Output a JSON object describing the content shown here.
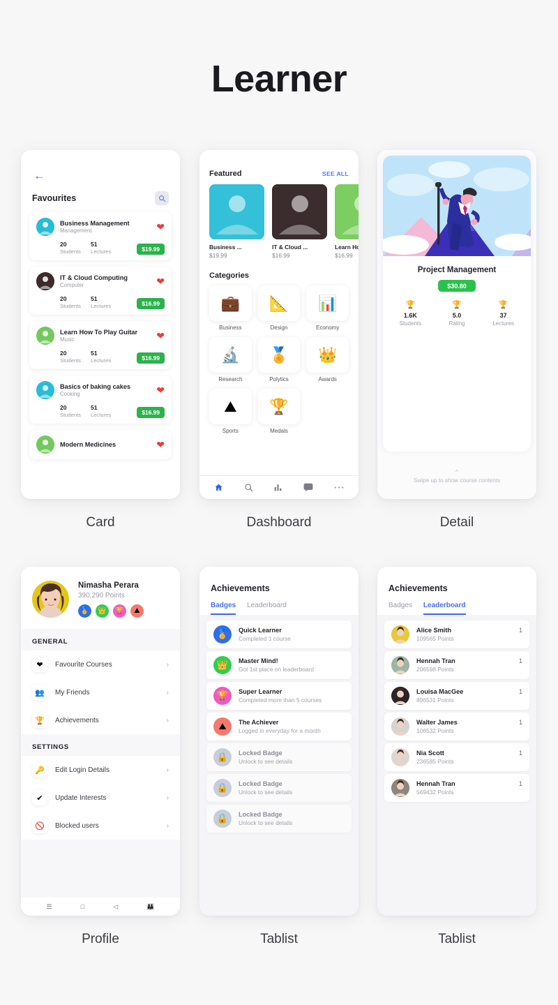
{
  "title": "Learner",
  "captions": {
    "card": "Card",
    "dashboard": "Dashboard",
    "detail": "Detail",
    "profile": "Profile",
    "tablist1": "Tablist",
    "tablist2": "Tablist"
  },
  "card_screen": {
    "back_icon": "back-arrow-icon",
    "header": "Favourites",
    "search_icon": "search-icon",
    "students_label": "Students",
    "lectures_label": "Lectures",
    "courses": [
      {
        "name": "Business Management",
        "category": "Management",
        "students": "20",
        "lectures": "51",
        "price": "$19.99",
        "avatar_color": "#29bcd8",
        "favorite": true
      },
      {
        "name": "IT & Cloud Computing",
        "category": "Computer",
        "students": "20",
        "lectures": "51",
        "price": "$16.99",
        "avatar_color": "#3c2a2c",
        "favorite": true
      },
      {
        "name": "Learn How To Play Guitar",
        "category": "Music",
        "students": "20",
        "lectures": "51",
        "price": "$16.99",
        "avatar_color": "#74c95e",
        "favorite": true
      },
      {
        "name": "Basics of baking cakes",
        "category": "Cooking",
        "students": "20",
        "lectures": "51",
        "price": "$16.99",
        "avatar_color": "#29bcd8",
        "favorite": true
      },
      {
        "name": "Modern Medicines",
        "category": "",
        "students": "",
        "lectures": "",
        "price": "",
        "avatar_color": "#74c95e",
        "favorite": true
      }
    ]
  },
  "dashboard_screen": {
    "featured_title": "Featured",
    "see_all": "SEE ALL",
    "categories_title": "Categories",
    "featured": [
      {
        "name": "Business ...",
        "price": "$19.99",
        "bg": "#34c0d8"
      },
      {
        "name": "IT & Cloud ...",
        "price": "$16.99",
        "bg": "#3b2c2e"
      },
      {
        "name": "Learn How",
        "price": "$16.99",
        "bg": "#7bce5f"
      }
    ],
    "categories": [
      {
        "label": "Business",
        "icon": "briefcase-icon"
      },
      {
        "label": "Design",
        "icon": "ruler-pencil-icon"
      },
      {
        "label": "Economy",
        "icon": "pie-chart-icon"
      },
      {
        "label": "Research",
        "icon": "microscope-icon"
      },
      {
        "label": "Polytics",
        "icon": "medal-icon"
      },
      {
        "label": "Awards",
        "icon": "crown-icon"
      },
      {
        "label": "Sports",
        "icon": "mountain-flag-icon"
      },
      {
        "label": "Medals",
        "icon": "trophy-icon"
      }
    ],
    "tabbar": [
      {
        "icon": "home-icon",
        "active": true
      },
      {
        "icon": "search-icon",
        "active": false
      },
      {
        "icon": "chart-bars-icon",
        "active": false
      },
      {
        "icon": "chat-icon",
        "active": false
      },
      {
        "icon": "more-dots-icon",
        "active": false
      }
    ]
  },
  "detail_screen": {
    "course_title": "Project Management",
    "price": "$30.80",
    "stats": [
      {
        "icon": "trophy-icon",
        "value": "1.6K",
        "label": "Students"
      },
      {
        "icon": "trophy-icon",
        "value": "5.0",
        "label": "Rating"
      },
      {
        "icon": "trophy-icon",
        "value": "37",
        "label": "Lectures"
      }
    ],
    "swipe_chevron": "chevron-up-icon",
    "swipe_text": "Swipe up to show course contents"
  },
  "profile_screen": {
    "name": "Nimasha Perara",
    "points": "390,290 Points",
    "badges": [
      {
        "icon": "medal-icon",
        "color": "#2f6fe8"
      },
      {
        "icon": "crown-icon",
        "color": "#2ece4e"
      },
      {
        "icon": "trophy-icon",
        "color": "#f05ac0"
      },
      {
        "icon": "mountain-flag-icon",
        "color": "#f4796c"
      }
    ],
    "general_label": "GENERAL",
    "settings_label": "SETTINGS",
    "general_items": [
      {
        "label": "Favourite Courses",
        "icon": "heart-icon"
      },
      {
        "label": "My Friends",
        "icon": "friends-icon"
      },
      {
        "label": "Achievements",
        "icon": "trophy-icon"
      }
    ],
    "settings_items": [
      {
        "label": "Edit Login Details",
        "icon": "key-icon"
      },
      {
        "label": "Update Interests",
        "icon": "check-icon"
      },
      {
        "label": "Blocked users",
        "icon": "block-icon"
      }
    ],
    "chevron": "chevron-right-icon",
    "android_nav": [
      {
        "icon": "menu-icon"
      },
      {
        "icon": "square-icon"
      },
      {
        "icon": "back-triangle-icon"
      },
      {
        "icon": "accessibility-icon"
      }
    ]
  },
  "badges_screen": {
    "title": "Achievements",
    "tabs": [
      {
        "label": "Badges",
        "active": true
      },
      {
        "label": "Leaderboard",
        "active": false
      }
    ],
    "items": [
      {
        "name": "Quick Learner",
        "sub": "Completed 1 course",
        "icon": "medal-icon",
        "color": "#2f6fe8",
        "locked": false
      },
      {
        "name": "Master Mind!",
        "sub": "Got 1st place on leaderboard",
        "icon": "crown-icon",
        "color": "#2ece4e",
        "locked": false
      },
      {
        "name": "Super Learner",
        "sub": "Completed more than 5 courses",
        "icon": "trophy-icon",
        "color": "#f05ac0",
        "locked": false
      },
      {
        "name": "The Achiever",
        "sub": "Logged in everyday for a month",
        "icon": "mountain-flag-icon",
        "color": "#f4796c",
        "locked": false
      },
      {
        "name": "Locked Badge",
        "sub": "Unlock to see details",
        "icon": "lock-icon",
        "color": "#c8cdd8",
        "locked": true
      },
      {
        "name": "Locked Badge",
        "sub": "Unlock to see details",
        "icon": "lock-icon",
        "color": "#c8cdd8",
        "locked": true
      },
      {
        "name": "Locked Badge",
        "sub": "Unlock to see details",
        "icon": "lock-icon",
        "color": "#c8cdd8",
        "locked": true
      }
    ]
  },
  "leaderboard_screen": {
    "title": "Achievements",
    "tabs": [
      {
        "label": "Badges",
        "active": false
      },
      {
        "label": "Leaderboard",
        "active": true
      }
    ],
    "items": [
      {
        "name": "Alice Smith",
        "sub": "109565 Points",
        "rank": "1",
        "avatar_color": "#e8c83c"
      },
      {
        "name": "Hennah Tran",
        "sub": "206598 Points",
        "rank": "1",
        "avatar_color": "#9fb6a4"
      },
      {
        "name": "Louisa MacGee",
        "sub": "896531 Points",
        "rank": "1",
        "avatar_color": "#2a2328"
      },
      {
        "name": "Walter James",
        "sub": "106532 Points",
        "rank": "1",
        "avatar_color": "#d8d3cf"
      },
      {
        "name": "Nia Scott",
        "sub": "236585 Points",
        "rank": "1",
        "avatar_color": "#ded7cf"
      },
      {
        "name": "Hennah Tran",
        "sub": "569432 Points",
        "rank": "1",
        "avatar_color": "#8e857c"
      }
    ]
  }
}
